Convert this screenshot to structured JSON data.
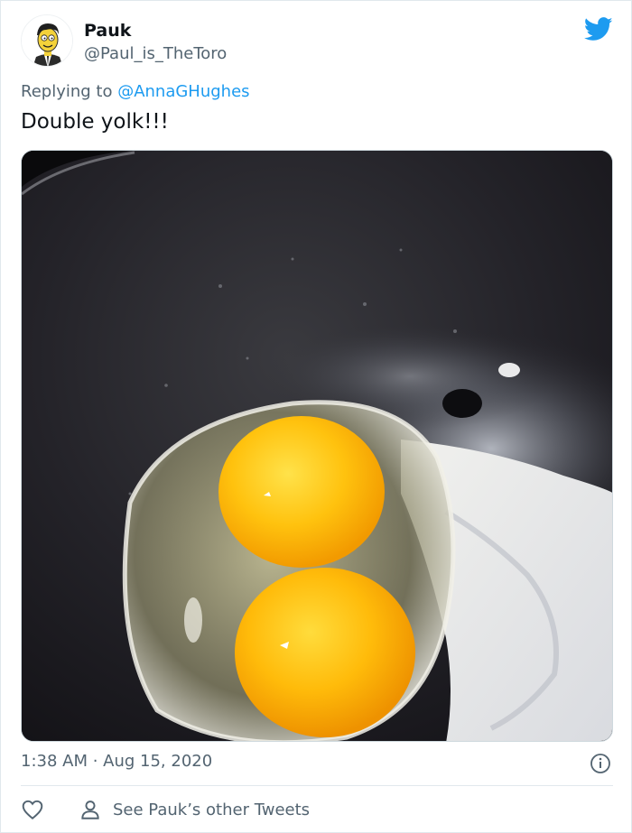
{
  "tweet": {
    "author_name": "Pauk",
    "author_handle": "@Paul_is_TheToro",
    "reply_prefix": "Replying to ",
    "reply_mention": "@AnnaGHughes",
    "text": "Double yolk!!!",
    "timestamp": "1:38 AM · Aug 15, 2020",
    "other_tweets_label": "See Pauk’s other Tweets"
  },
  "colors": {
    "brand": "#1d9bf0",
    "secondary_text": "#536471",
    "primary_text": "#0f1419"
  },
  "icons": {
    "logo": "twitter-bird-icon",
    "info": "info-icon",
    "like": "heart-icon",
    "profile": "person-icon"
  },
  "image": {
    "alt": "Double yolk egg frying in a dark pan"
  }
}
